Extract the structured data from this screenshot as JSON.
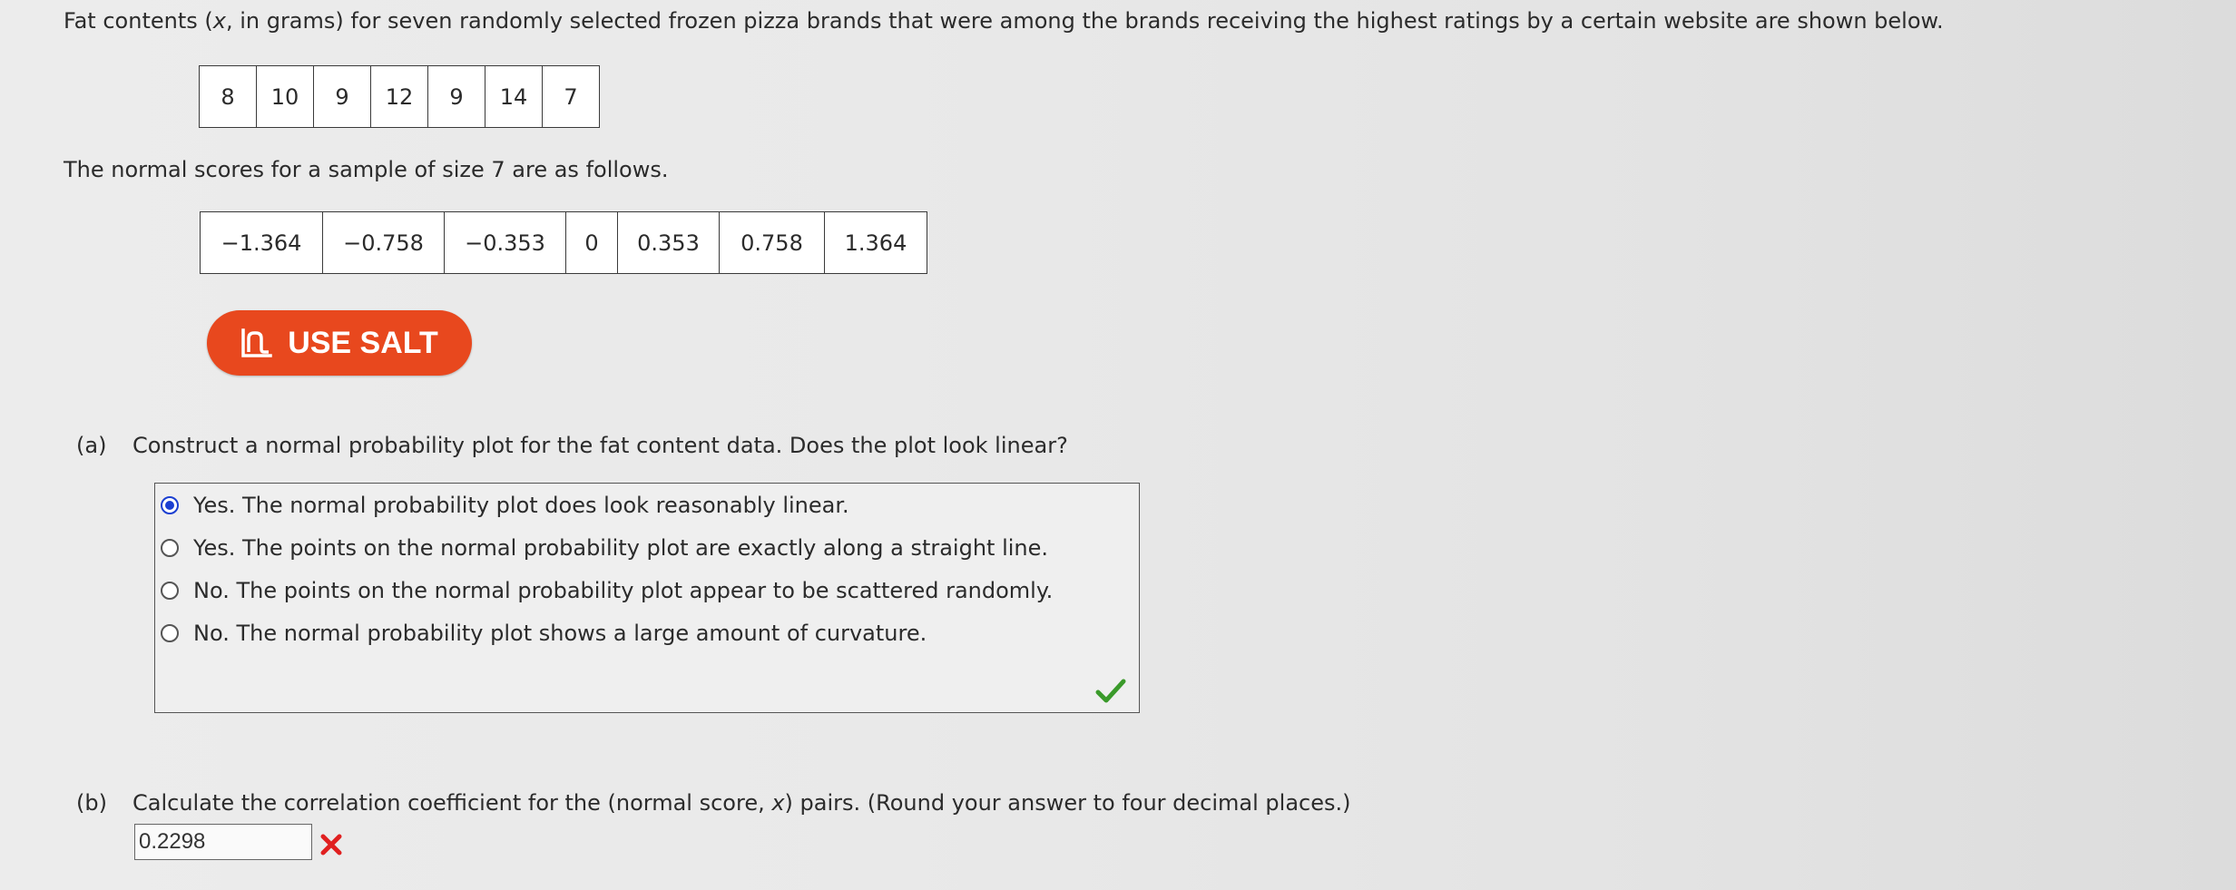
{
  "intro": {
    "before_var": "Fat contents (",
    "var": "x",
    "after_var": ", in grams) for seven randomly selected frozen pizza brands that were among the brands receiving the highest ratings by a certain website are shown below."
  },
  "fat_values": [
    "8",
    "10",
    "9",
    "12",
    "9",
    "14",
    "7"
  ],
  "normal_scores_intro": "The normal scores for a sample of size 7 are as follows.",
  "normal_scores": [
    "−1.364",
    "−0.758",
    "−0.353",
    "0",
    "0.353",
    "0.758",
    "1.364"
  ],
  "salt_button": {
    "label": "USE SALT",
    "icon": "salt-icon",
    "color": "#e8481e"
  },
  "part_a": {
    "letter": "(a)",
    "question": "Construct a normal probability plot for the fat content data. Does the plot look linear?",
    "options": [
      {
        "label": "Yes. The normal probability plot does look reasonably linear.",
        "selected": true
      },
      {
        "label": "Yes. The points on the normal probability plot are exactly along a straight line.",
        "selected": false
      },
      {
        "label": "No. The points on the normal probability plot appear to be scattered randomly.",
        "selected": false
      },
      {
        "label": "No. The normal probability plot shows a large amount of curvature.",
        "selected": false
      }
    ],
    "status_icon": "check-icon",
    "status_color": "#3a9a2a"
  },
  "part_b": {
    "letter": "(b)",
    "question_before": "Calculate the correlation coefficient for the (normal score, ",
    "question_var": "x",
    "question_after": ") pairs. (Round your answer to four decimal places.)",
    "answer_value": "0.2298",
    "status_icon": "x-icon",
    "status_color": "#e02020"
  }
}
